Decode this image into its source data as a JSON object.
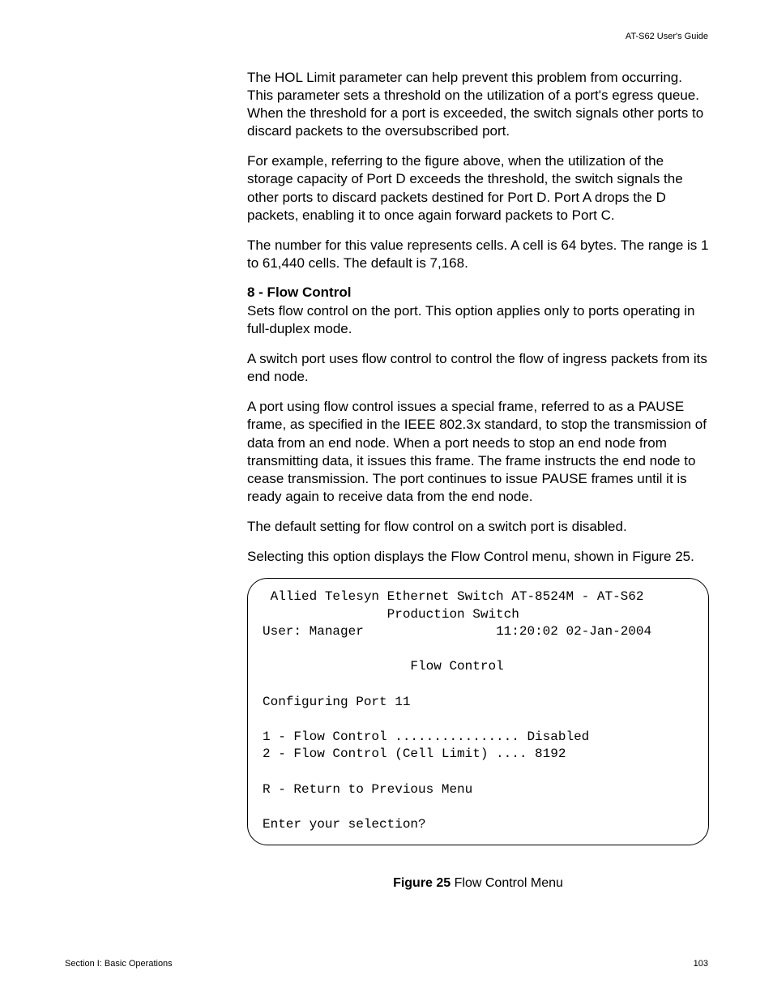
{
  "header": {
    "guide_title": "AT-S62 User's Guide"
  },
  "body": {
    "p1": "The HOL Limit parameter can help prevent this problem from occurring. This parameter sets a threshold on the utilization of a port's egress queue. When the threshold for a port is exceeded, the switch signals other ports to discard packets to the oversubscribed port.",
    "p2": "For example, referring to the figure above, when the utilization of the storage capacity of Port D exceeds the threshold, the switch signals the other ports to discard packets destined for Port D. Port A drops the D packets, enabling it to once again forward packets to Port C.",
    "p3": "The number for this value represents cells. A cell is 64 bytes. The range is 1 to 61,440 cells. The default is 7,168.",
    "h1": "8 - Flow Control",
    "p4": "Sets flow control on the port. This option applies only to ports operating in full-duplex mode.",
    "p5": "A switch port uses flow control to control the flow of ingress packets from its end node.",
    "p6": "A port using flow control issues a special frame, referred to as a PAUSE frame, as specified in the IEEE 802.3x standard, to stop the transmission of data from an end node. When a port needs to stop an end node from transmitting data, it issues this frame. The frame instructs the end node to cease transmission. The port continues to issue PAUSE frames until it is ready again to receive data from the end node.",
    "p7": "The default setting for flow control on a switch port is disabled.",
    "p8": "Selecting this option displays the Flow Control menu, shown in Figure 25."
  },
  "terminal": {
    "line1": " Allied Telesyn Ethernet Switch AT-8524M - AT-S62",
    "line2": "                Production Switch",
    "line3a": "User: Manager",
    "line3b": "11:20:02 02-Jan-2004",
    "line4": "                   Flow Control",
    "line5": "Configuring Port 11",
    "line6": "1 - Flow Control ................ Disabled",
    "line7": "2 - Flow Control (Cell Limit) .... 8192",
    "line8": "R - Return to Previous Menu",
    "line9": "Enter your selection?"
  },
  "figure": {
    "label": "Figure 25",
    "caption": "  Flow Control Menu"
  },
  "footer": {
    "section": "Section I: Basic Operations",
    "page": "103"
  }
}
